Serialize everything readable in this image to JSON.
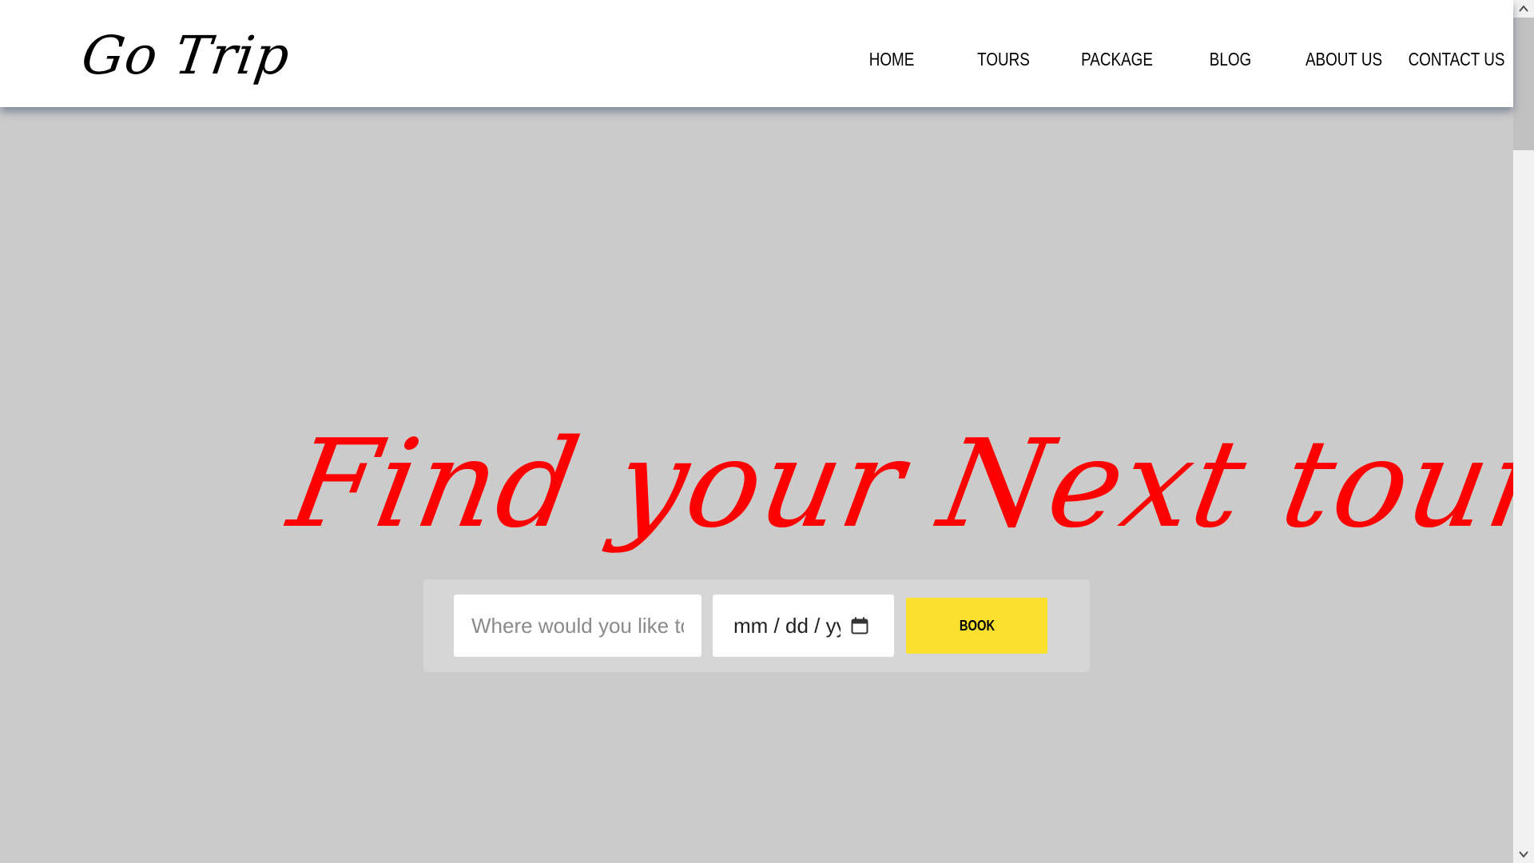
{
  "header": {
    "logo": "Go Trip",
    "nav": [
      {
        "label": "HOME"
      },
      {
        "label": "TOURS"
      },
      {
        "label": "PACKAGE"
      },
      {
        "label": "BLOG"
      },
      {
        "label": "ABOUT US"
      },
      {
        "label": "CONTACT US"
      }
    ]
  },
  "hero": {
    "title": "Find your Next tour!",
    "destination_placeholder": "Where would you like to go?",
    "destination_value": "",
    "date_placeholder": "mm / dd / yyyy",
    "book_label": "BOOK"
  },
  "icons": {
    "calendar": "calendar-icon",
    "scroll_up": "chevron-up-icon",
    "scroll_down": "chevron-down-icon"
  },
  "colors": {
    "header_bg": "#ffffff",
    "hero_bg": "#cbcbcb",
    "title": "#ff0000",
    "book_button": "#fce02e",
    "panel_bg": "#d6d6d6"
  }
}
